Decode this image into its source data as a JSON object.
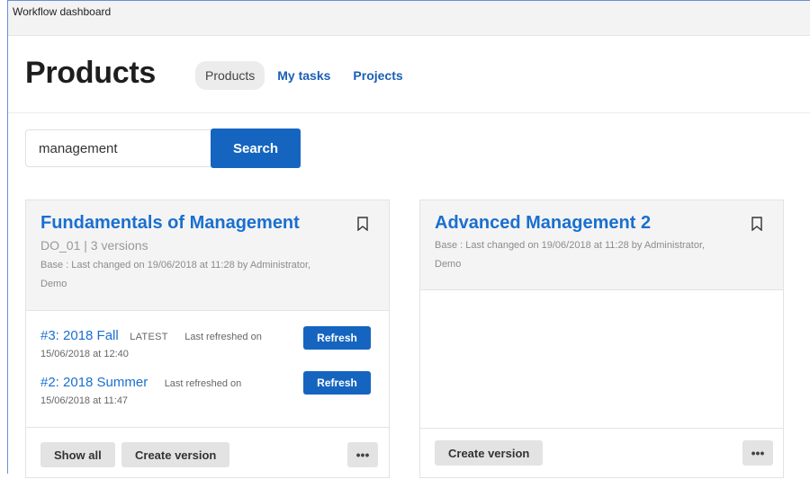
{
  "window": {
    "title": "Workflow dashboard"
  },
  "header": {
    "title": "Products",
    "nav": [
      {
        "label": "Products",
        "active": true
      },
      {
        "label": "My tasks",
        "active": false
      },
      {
        "label": "Projects",
        "active": false
      }
    ]
  },
  "search": {
    "value": "management",
    "button_label": "Search"
  },
  "cards": [
    {
      "title": "Fundamentals of Management",
      "code_line": "DO_01  | 3 versions",
      "meta_line1": "Base : Last changed on 19/06/2018 at 11:28 by Administrator,",
      "meta_line2": "Demo",
      "versions": [
        {
          "name": "#3: 2018 Fall",
          "badge": "LATEST",
          "refreshed": "Last refreshed on",
          "refreshed_date": "15/06/2018 at 12:40",
          "button": "Refresh"
        },
        {
          "name": "#2: 2018 Summer",
          "badge": "",
          "refreshed": "Last refreshed on",
          "refreshed_date": "15/06/2018 at 11:47",
          "button": "Refresh"
        }
      ],
      "footer": {
        "show_all": "Show all",
        "create_version": "Create version",
        "more": "•••"
      }
    },
    {
      "title": "Advanced Management 2",
      "meta_line1": "Base : Last changed on 19/06/2018 at 11:28 by Administrator,",
      "meta_line2": "Demo",
      "footer": {
        "create_version": "Create version",
        "more": "•••"
      }
    }
  ],
  "icons": {
    "bookmark": "bookmark-icon"
  },
  "colors": {
    "accent": "#1565c0",
    "link": "#1a6fcf"
  }
}
